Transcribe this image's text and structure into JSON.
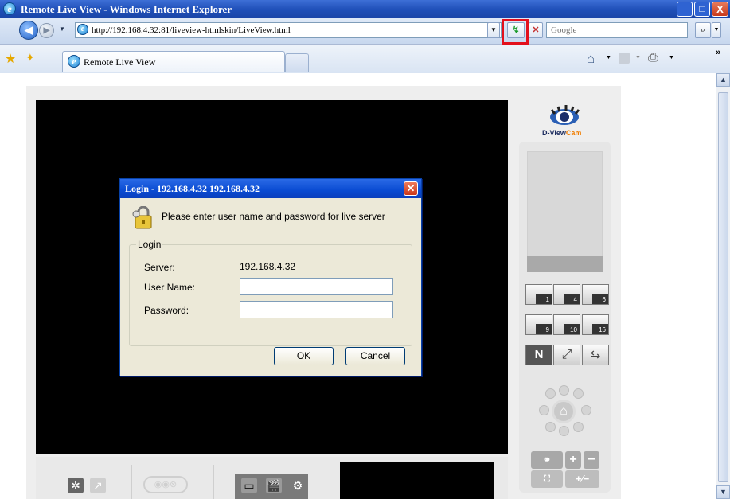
{
  "window": {
    "title": "Remote Live View - Windows Internet Explorer",
    "minimize": "_",
    "maximize": "□",
    "close": "X"
  },
  "addressbar": {
    "url": "http://192.168.4.32:81/liveview-htmlskin/LiveView.html",
    "search_placeholder": "Google"
  },
  "tabs": [
    {
      "label": "Remote Live View"
    }
  ],
  "brand": {
    "logo_text_main": "D-View",
    "logo_text_accent": "Cam"
  },
  "layout_buttons": [
    {
      "label": "1"
    },
    {
      "label": "4"
    },
    {
      "label": "6"
    },
    {
      "label": "9"
    },
    {
      "label": "10"
    },
    {
      "label": "16"
    }
  ],
  "dialog": {
    "title": "Login - 192.168.4.32 192.168.4.32",
    "message": "Please enter user name and password for live server",
    "group_label": "Login",
    "server_label": "Server:",
    "server_value": "192.168.4.32",
    "username_label": "User Name:",
    "username_value": "",
    "password_label": "Password:",
    "password_value": "",
    "ok_label": "OK",
    "cancel_label": "Cancel"
  },
  "colors": {
    "highlight": "#e3101c",
    "video_bg": "#000000"
  }
}
